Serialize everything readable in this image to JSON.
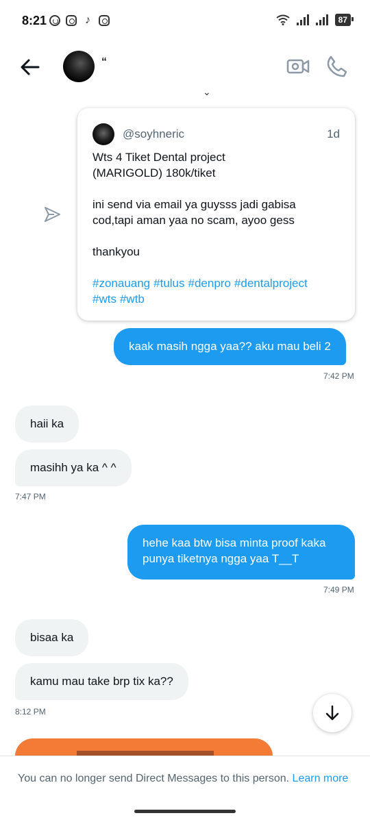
{
  "status_bar": {
    "time": "8:21",
    "battery": "87"
  },
  "header": {
    "name": "“",
    "icons": [
      "back-arrow-icon",
      "avatar",
      "video-call-icon",
      "phone-call-icon"
    ]
  },
  "thread": {
    "shared_tweet": {
      "handle": "@soyhneric",
      "time": "1d",
      "lines": [
        "Wts 4 Tiket Dental project",
        "(MARIGOLD) 180k/tiket",
        "",
        "ini send via email ya guysss jadi gabisa",
        "cod,tapi aman yaa no scam, ayoo gess",
        "",
        "thankyou",
        ""
      ],
      "hashtags_line1": [
        "#zonauang",
        "#tulus",
        "#denpro",
        "#dentalproject"
      ],
      "hashtags_line2": [
        "#wts",
        "#wtb"
      ]
    },
    "messages": [
      {
        "dir": "out",
        "text": "kaak masih ngga yaa?? aku mau beli 2",
        "time": "7:42 PM"
      },
      {
        "dir": "in",
        "text": "haii ka"
      },
      {
        "dir": "in",
        "text": "masihh ya ka ^ ^",
        "time": "7:47 PM"
      },
      {
        "dir": "out",
        "text_line1": "hehe kaa btw bisa minta proof kaka",
        "text_line2": "punya tiketnya ngga yaa T__T",
        "time": "7:49 PM"
      },
      {
        "dir": "in",
        "text": "bisaa ka"
      },
      {
        "dir": "in",
        "text": "kamu mau take brp tix ka??",
        "time": "8:12 PM"
      }
    ]
  },
  "footer": {
    "notice": "You can no longer send Direct Messages to this person.",
    "link": "Learn more"
  },
  "colors": {
    "accent": "#1d9bf0",
    "incoming_bubble": "#eff3f4",
    "muted_text": "#536471",
    "image_preview": "#f37b35"
  }
}
